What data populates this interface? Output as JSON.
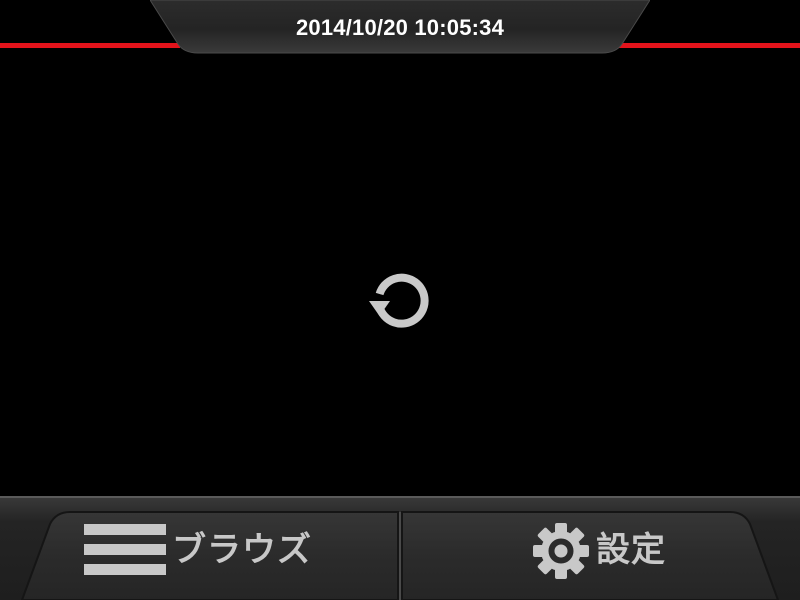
{
  "header": {
    "datetime": "2014/10/20 10:05:34"
  },
  "main": {
    "loading_icon": "reload-icon"
  },
  "bottom_bar": {
    "browse": {
      "label": "ブラウズ",
      "icon": "menu-icon"
    },
    "settings": {
      "label": "設定",
      "icon": "gear-icon"
    }
  },
  "colors": {
    "accent": "#e3131b",
    "background": "#000000",
    "label": "#c8c8c8",
    "header_text": "#ffffff"
  }
}
